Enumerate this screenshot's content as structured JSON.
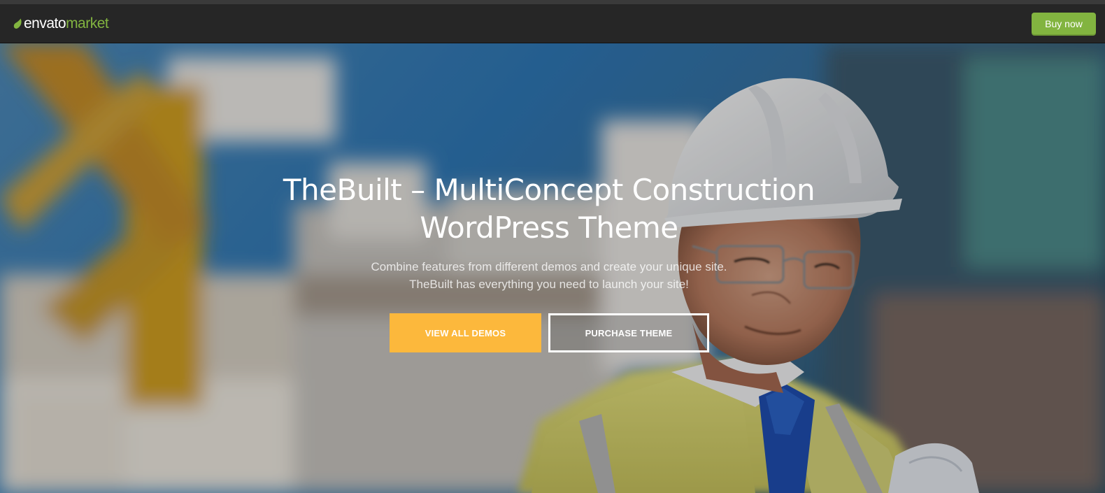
{
  "brand": {
    "name_part1": "envato",
    "name_part2": "market",
    "accent_color": "#82b440",
    "logo_icon": "leaf-icon"
  },
  "navbar": {
    "buy_label": "Buy now",
    "buy_color": "#82b440"
  },
  "hero": {
    "title_line1": "TheBuilt – MultiConcept Construction",
    "title_line2": "WordPress Theme",
    "subtitle_line1": "Combine features from different demos and create your unique site.",
    "subtitle_line2": "TheBuilt has everything you need to launch your site!",
    "primary_button": "VIEW ALL DEMOS",
    "primary_color": "#fcb83c",
    "secondary_button": "PURCHASE THEME",
    "background_image": "construction worker in white hard hat and high-visibility vest"
  }
}
